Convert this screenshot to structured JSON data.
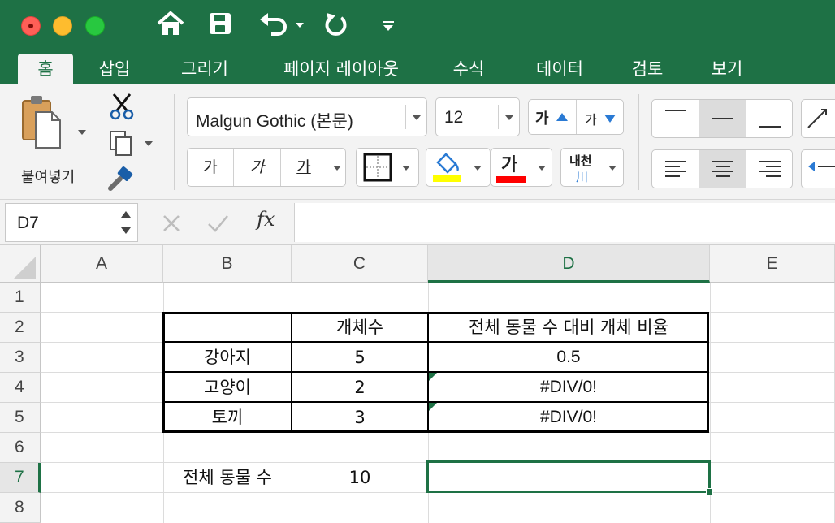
{
  "quick_access": {
    "home_icon": "home-icon",
    "save_icon": "save-icon",
    "undo_icon": "undo-icon",
    "redo_icon": "redo-icon",
    "customize_icon": "customize-toolbar-icon"
  },
  "tabs": [
    {
      "label": "홈",
      "active": true
    },
    {
      "label": "삽입"
    },
    {
      "label": "그리기"
    },
    {
      "label": "페이지 레이아웃"
    },
    {
      "label": "수식"
    },
    {
      "label": "데이터"
    },
    {
      "label": "검토"
    },
    {
      "label": "보기"
    }
  ],
  "ribbon": {
    "paste_label": "붙여넣기",
    "font_name": "Malgun Gothic (본문)",
    "font_size": "12",
    "grow_font": "가",
    "shrink_font": "가",
    "bold": "가",
    "italic": "가",
    "underline": "가",
    "font_color_glyph": "가",
    "phonetic_top": "내천",
    "phonetic_bottom": "川",
    "fill_color": "#ffff00",
    "font_color": "#ff0000"
  },
  "formula_bar": {
    "name_box": "D7",
    "fx": "fx",
    "value": ""
  },
  "grid": {
    "columns": [
      "A",
      "B",
      "C",
      "D",
      "E"
    ],
    "selected_column": "D",
    "rows": [
      "1",
      "2",
      "3",
      "4",
      "5",
      "6",
      "7",
      "8"
    ],
    "selected_row": "7",
    "cells": {
      "C2": "개체수",
      "D2": "전체 동물 수 대비 개체 비율",
      "B3": "강아지",
      "C3": "5",
      "D3": "0.5",
      "B4": "고양이",
      "C4": "2",
      "D4": "#DIV/0!",
      "B5": "토끼",
      "C5": "3",
      "D5": "#DIV/0!",
      "B7": "전체 동물 수",
      "C7": "10"
    },
    "accent_color": "#1e7145"
  }
}
